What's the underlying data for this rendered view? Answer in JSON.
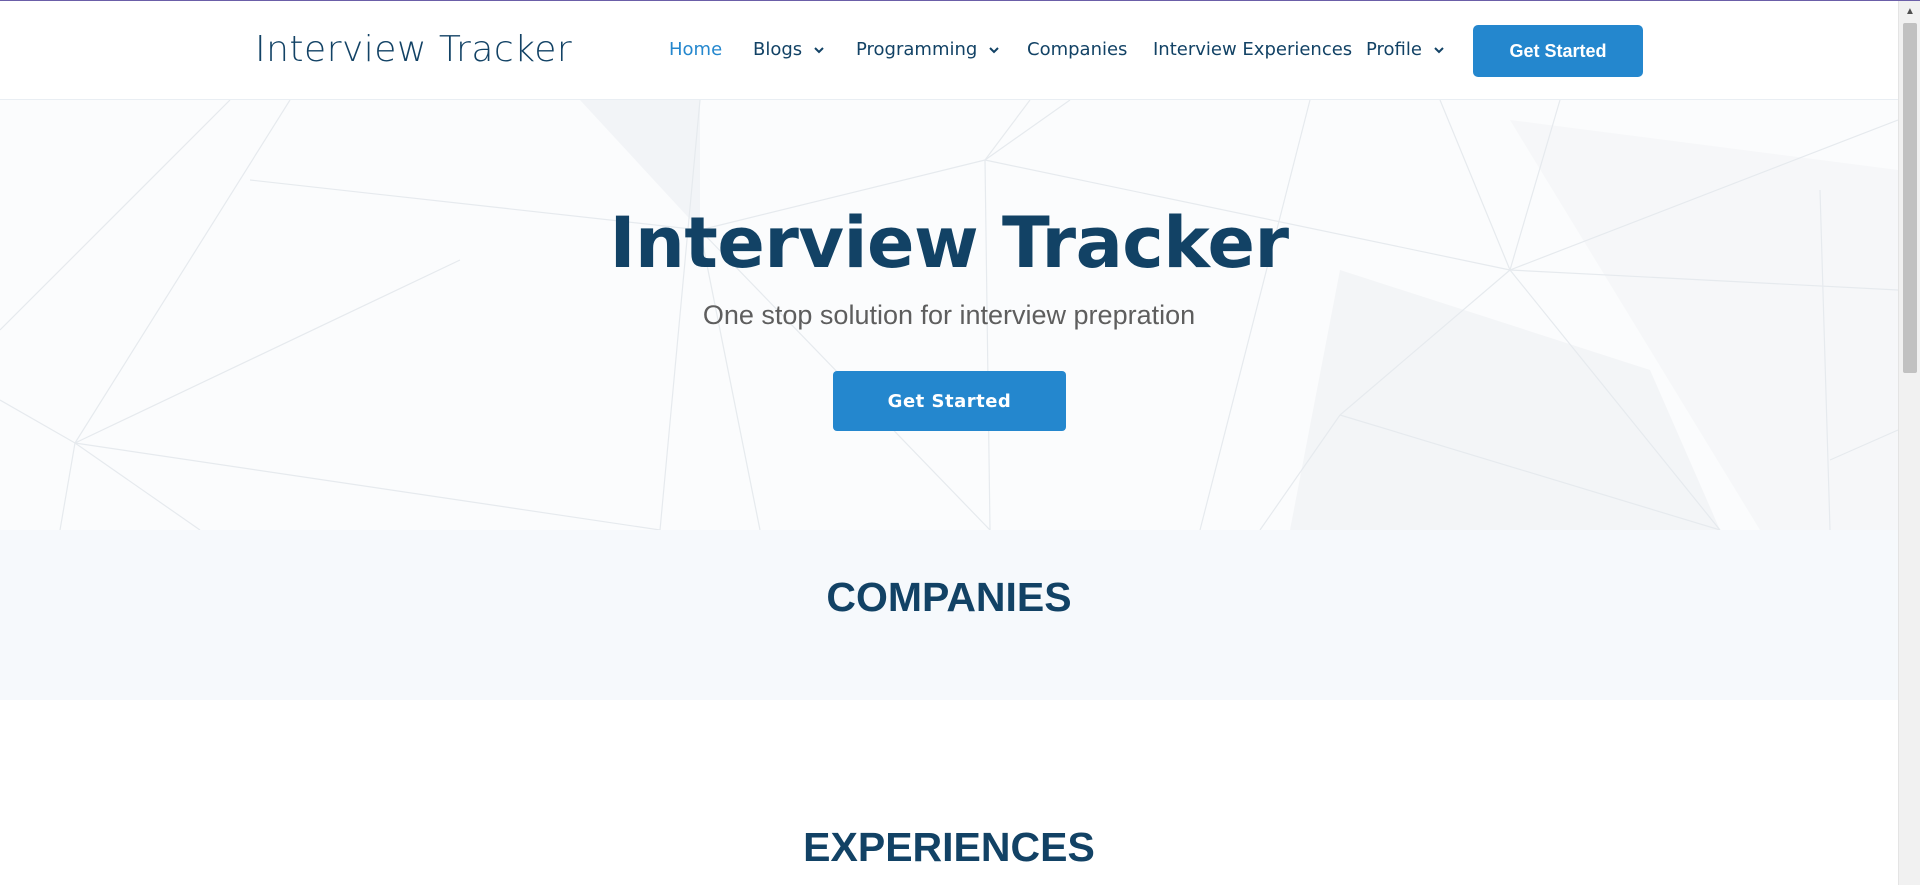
{
  "header": {
    "logo": "Interview Tracker",
    "nav": [
      {
        "label": "Home",
        "active": true,
        "dropdown": false
      },
      {
        "label": "Blogs",
        "active": false,
        "dropdown": true
      },
      {
        "label": "Programming",
        "active": false,
        "dropdown": true
      },
      {
        "label": "Companies",
        "active": false,
        "dropdown": false
      },
      {
        "label": "Interview Experiences",
        "active": false,
        "dropdown": false
      },
      {
        "label": "Profile",
        "active": false,
        "dropdown": true
      }
    ],
    "cta_label": "Get Started"
  },
  "hero": {
    "title": "Interview Tracker",
    "subtitle": "One stop solution for interview prepration",
    "cta_label": "Get Started"
  },
  "sections": {
    "companies_title": "COMPANIES",
    "experiences_title": "EXPERIENCES"
  },
  "colors": {
    "brand": "#124265",
    "accent": "#2487ce",
    "section_bg": "#f6f9fc"
  }
}
